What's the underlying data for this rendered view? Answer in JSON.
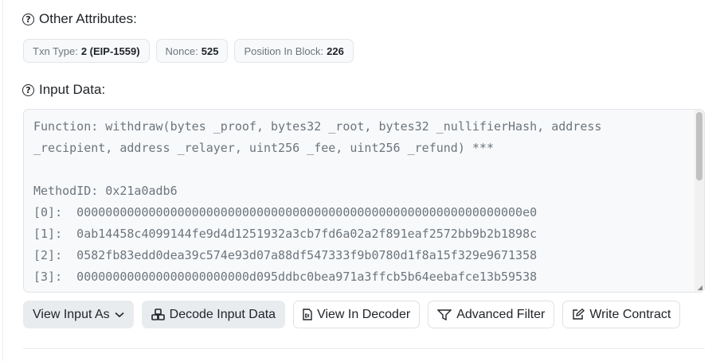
{
  "other_attributes": {
    "title": "Other Attributes:",
    "badges": [
      {
        "label": "Txn Type:",
        "value": "2 (EIP-1559)"
      },
      {
        "label": "Nonce:",
        "value": "525"
      },
      {
        "label": "Position In Block:",
        "value": "226"
      }
    ]
  },
  "input_data": {
    "title": "Input Data:",
    "lines": [
      "Function: withdraw(bytes _proof, bytes32 _root, bytes32 _nullifierHash, address",
      "_recipient, address _relayer, uint256 _fee, uint256 _refund) ***",
      "",
      "MethodID: 0x21a0adb6",
      "[0]:  00000000000000000000000000000000000000000000000000000000000000e0",
      "[1]:  0ab14458c4099144fe9d4d1251932a3cb7fd6a02a2f891eaf2572bb9b2b1898c",
      "[2]:  0582fb83edd0dea39c574e93d07a88df547333f9b0780d1f8a15f329e9671358",
      "[3]:  000000000000000000000000d095ddbc0bea971a3ffcb5b64eebafce13b59538"
    ]
  },
  "toolbar": {
    "view_input_as": "View Input As",
    "decode_input_data": "Decode Input Data",
    "view_in_decoder": "View In Decoder",
    "advanced_filter": "Advanced Filter",
    "write_contract": "Write Contract"
  },
  "icons": {
    "help": "question-circle",
    "chevron": "chevron-down",
    "decode": "cubes",
    "decoder": "file-binary",
    "filter": "filter",
    "write": "pen-to-square"
  }
}
